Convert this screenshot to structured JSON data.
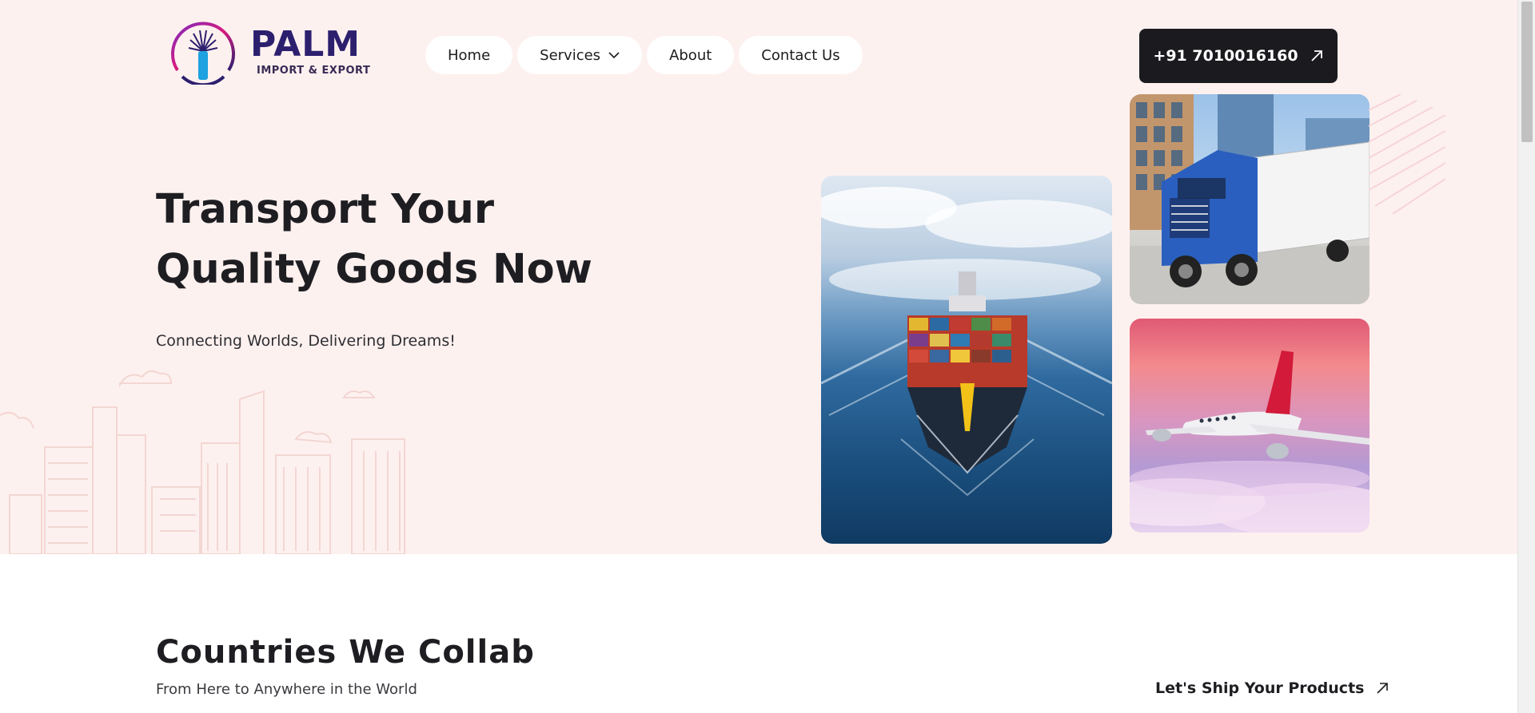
{
  "brand": {
    "name": "PALM",
    "tagline": "IMPORT & EXPORT"
  },
  "nav": {
    "items": [
      {
        "label": "Home"
      },
      {
        "label": "Services",
        "has_dropdown": true
      },
      {
        "label": "About"
      },
      {
        "label": "Contact Us"
      }
    ]
  },
  "phone_button": {
    "label": "+91 7010016160",
    "icon": "arrow-up-right-icon"
  },
  "hero": {
    "title": "Transport Your Quality Goods Now",
    "subtitle": "Connecting Worlds, Delivering Dreams!"
  },
  "collab": {
    "title": "Countries We Collab",
    "subtitle": "From Here to Anywhere in the World",
    "link_label": "Let's Ship Your Products",
    "link_icon": "arrow-up-right-icon"
  },
  "colors": {
    "hero_bg": "#fdf1ef",
    "dark_button": "#1b1b1f",
    "brand_navy": "#2c1f6e",
    "brand_pink": "#d81b7f"
  }
}
